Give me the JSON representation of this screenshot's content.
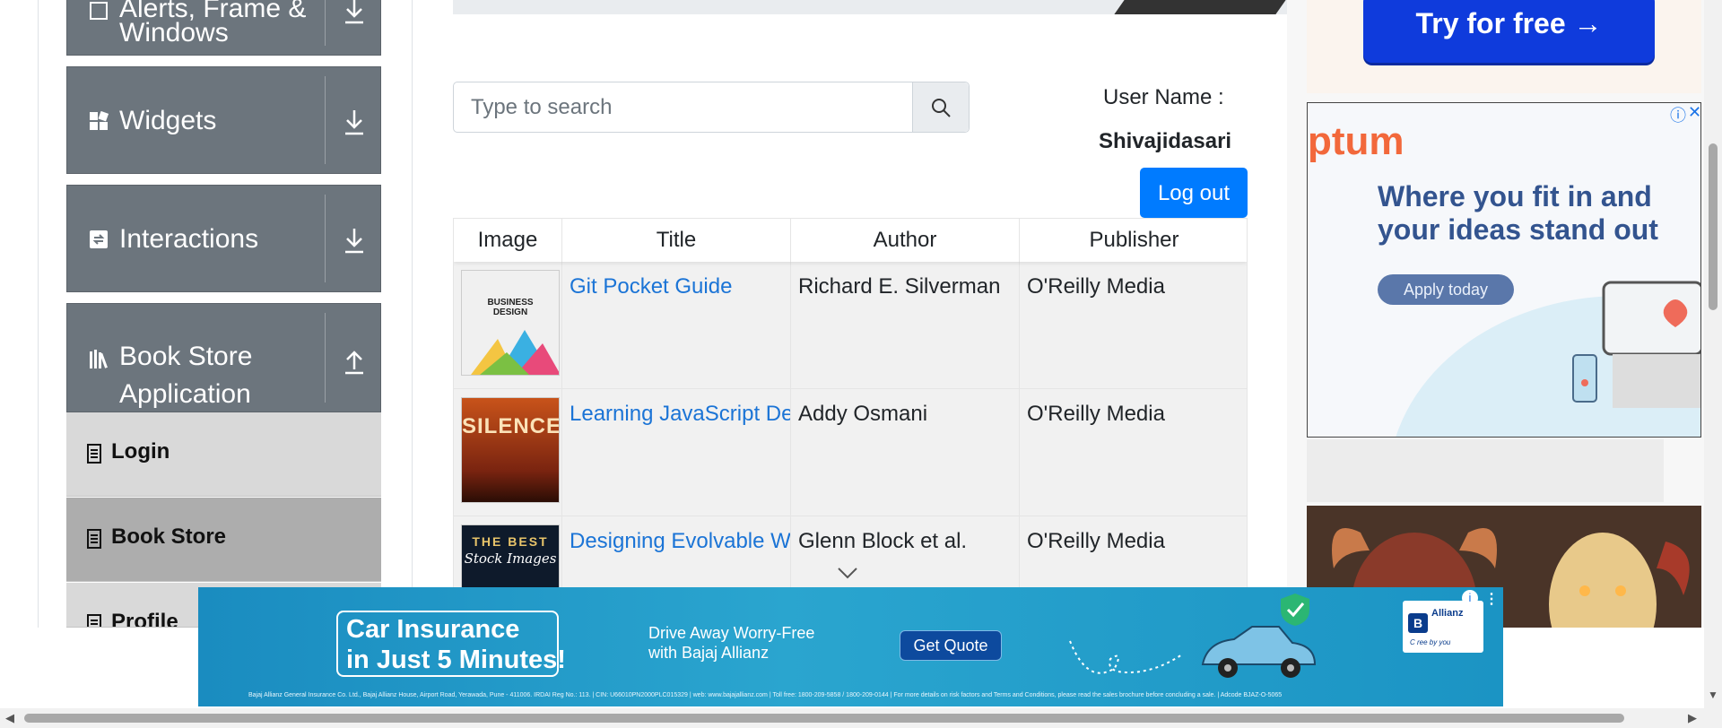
{
  "sidebar": {
    "groups": [
      {
        "label": "Alerts, Frame &",
        "label2": "Windows",
        "icon": "window-icon",
        "arrow": "download-arrow-icon"
      },
      {
        "label": "Widgets",
        "icon": "widgets-icon",
        "arrow": "download-arrow-icon"
      },
      {
        "label": "Interactions",
        "icon": "interactions-icon",
        "arrow": "download-arrow-icon"
      },
      {
        "label": "Book Store",
        "label2": "Application",
        "icon": "books-icon",
        "arrow": "upload-arrow-icon"
      }
    ],
    "items": [
      {
        "label": "Login",
        "active": false
      },
      {
        "label": "Book Store",
        "active": true
      },
      {
        "label": "Profile",
        "active": false
      }
    ]
  },
  "search": {
    "placeholder": "Type to search",
    "value": ""
  },
  "user": {
    "label": "User Name :",
    "value": "Shivajidasari"
  },
  "logout_label": "Log out",
  "table": {
    "headers": [
      "Image",
      "Title",
      "Author",
      "Publisher"
    ],
    "rows": [
      {
        "title": "Git Pocket Guide",
        "author": "Richard E. Silverman",
        "publisher": "O'Reilly Media",
        "cover_text": "BUSINESS DESIGN"
      },
      {
        "title": "Learning JavaScript Design Patterns",
        "author": "Addy Osmani",
        "publisher": "O'Reilly Media",
        "cover_text": "SILENCE"
      },
      {
        "title": "Designing Evolvable Web APIs with ASP.NET",
        "author": "Glenn Block et al.",
        "publisher": "O'Reilly Media",
        "cover_text": "THE BEST",
        "cover_text2": "Stock Images"
      }
    ]
  },
  "ads": {
    "try_free": "Try for free →",
    "optum_logo": "ptum",
    "optum_headline": [
      "Where you fit in and",
      "your ideas stand out"
    ],
    "optum_cta": "Apply today",
    "insurance_headline": [
      "Car Insurance",
      "in Just 5 Minutes!"
    ],
    "insurance_sub": [
      "Drive Away Worry-Free",
      "with Bajaj Allianz"
    ],
    "insurance_cta": "Get Quote",
    "brand": "Allianz",
    "brand_tagline": "C ree by you",
    "fine_print": "Bajaj Allianz General Insurance Co. Ltd., Bajaj Allianz House, Airport Road, Yerawada, Pune - 411006. IRDAI Reg No.: 113. | CIN: U66010PN2000PLC015329 | web: www.bajajallianz.com | Toll free: 1800-209-5858 / 1800-209-0144 | For more details on risk factors and Terms and Conditions, please read the sales brochure before concluding a sale. | Adcode BJAZ-O-5065"
  },
  "colors": {
    "primary": "#007bff",
    "sidebar_bg": "#6c757d",
    "link": "#1b74d6"
  }
}
